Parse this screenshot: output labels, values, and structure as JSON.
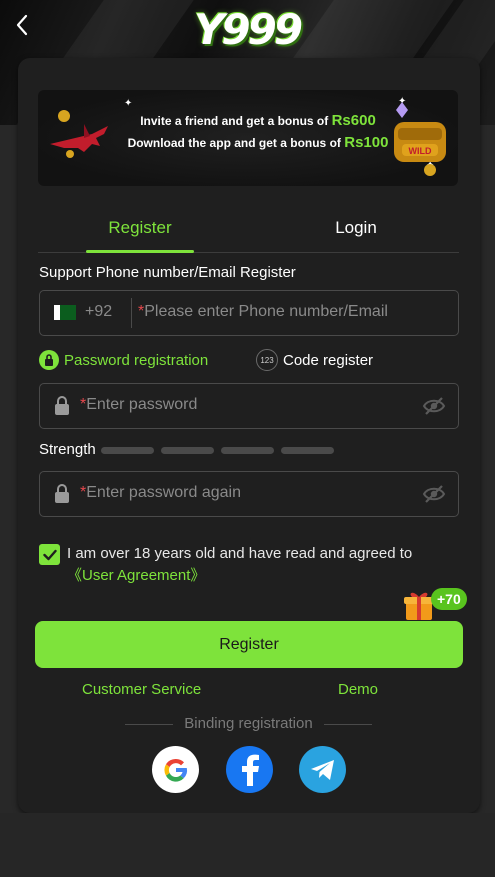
{
  "app": {
    "logo_text": "Y999"
  },
  "banner": {
    "line1_prefix": "Invite a friend and get a bonus of",
    "line1_amount": "Rs600",
    "line2_prefix": "Download the app and get a bonus of",
    "line2_amount": "Rs100"
  },
  "tabs": {
    "register": "Register",
    "login": "Login",
    "active": "register"
  },
  "form": {
    "support_label": "Support Phone number/Email Register",
    "country_code": "+92",
    "required_mark": "*",
    "phone_placeholder": "Please enter Phone number/Email",
    "mode_password": "Password registration",
    "mode_code": "Code register",
    "code_icon_text": "123",
    "password_placeholder": "Enter password",
    "strength_label": "Strength",
    "strength_level": 0,
    "password_again_placeholder": "Enter password again",
    "agree_checked": true,
    "agree_text": "I am over 18 years old and have read and agreed to ",
    "agree_link": "《User Agreement》",
    "bonus_badge": "+70",
    "register_button": "Register"
  },
  "footer": {
    "customer_service": "Customer Service",
    "demo": "Demo",
    "binding_label": "Binding registration"
  },
  "colors": {
    "accent": "#7ee33b",
    "background": "#282828",
    "card": "#1f1f1f",
    "required": "#e5484d"
  },
  "icons": [
    "back-icon",
    "plane-icon",
    "treasure-chest-icon",
    "pakistan-flag-icon",
    "lock-icon",
    "eye-off-icon",
    "code-123-icon",
    "check-icon",
    "gift-icon",
    "google-icon",
    "facebook-icon",
    "telegram-icon"
  ]
}
